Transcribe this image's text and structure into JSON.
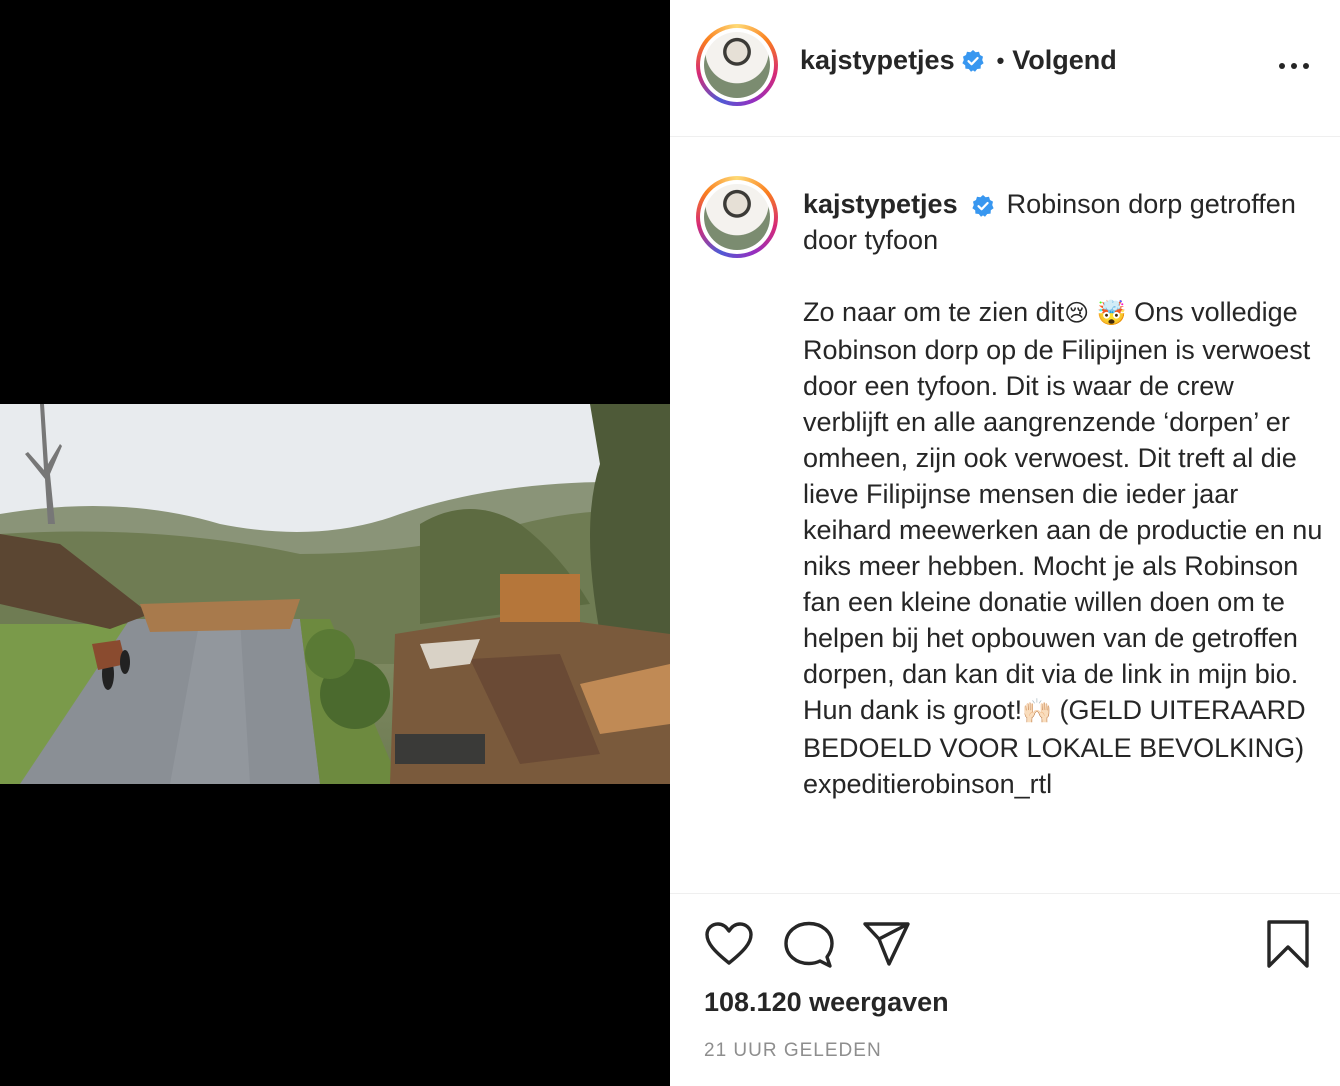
{
  "post": {
    "username": "kajstypetjes",
    "follow_status": "Volgend",
    "more_label": "•••",
    "caption": {
      "title_line": "Robinson dorp getroffen door tyfoon",
      "body_1": "Zo naar om te zien dit",
      "emoji_1": "😢",
      "emoji_2": "🤯",
      "body_2": "Ons volledige Robinson dorp op de Filipijnen is verwoest door een tyfoon. Dit is waar de crew verblijft en alle aangrenzende ‘dorpen’ er omheen, zijn ook verwoest. Dit treft al die lieve Filipijnse mensen die ieder jaar keihard meewerken aan de productie en nu niks meer hebben. Mocht je als Robinson fan een kleine donatie willen doen om te helpen bij het opbouwen van de getroffen dorpen, dan kan dit via de link in mijn bio. Hun dank is groot!",
      "emoji_3": "🙌🏻",
      "body_3": "(GELD UITERAARD BEDOELD VOOR LOKALE BEVOLKING)",
      "mention": "expeditierobinson_rtl"
    },
    "views": "108.120 weergaven",
    "timestamp": "21 UUR GELEDEN"
  },
  "icons": {
    "verified": "verified-badge-icon",
    "like": "heart-icon",
    "comment": "comment-icon",
    "share": "paper-plane-icon",
    "save": "bookmark-icon",
    "more": "more-options-icon"
  },
  "colors": {
    "verified_blue": "#3897f0",
    "text": "#262626",
    "muted": "#8e8e8e",
    "divider": "#efefef"
  }
}
